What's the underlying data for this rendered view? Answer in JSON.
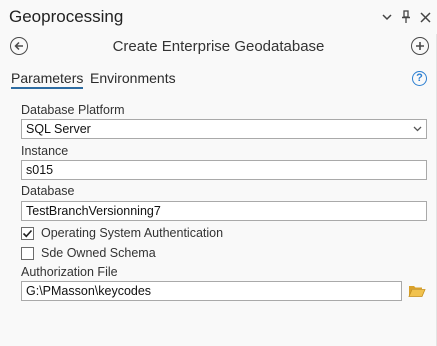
{
  "pane": {
    "title": "Geoprocessing",
    "controls": {
      "menu": "▾",
      "pin": "📌",
      "close": "✕"
    }
  },
  "tool": {
    "title": "Create Enterprise Geodatabase"
  },
  "tabs": [
    {
      "label": "Parameters",
      "active": true
    },
    {
      "label": "Environments",
      "active": false
    }
  ],
  "help": "?",
  "params": {
    "platform": {
      "label": "Database Platform",
      "value": "SQL Server"
    },
    "instance": {
      "label": "Instance",
      "value": "s015"
    },
    "database": {
      "label": "Database",
      "value": "TestBranchVersionning7"
    },
    "os_auth": {
      "label": "Operating System Authentication",
      "checked": true
    },
    "sde_schema": {
      "label": "Sde Owned Schema",
      "checked": false
    },
    "auth_file": {
      "label": "Authorization File",
      "value": "G:\\PMasson\\keycodes"
    }
  },
  "colors": {
    "accent": "#2d6ca2",
    "help": "#2c7fd1",
    "folder": "#e8b438"
  }
}
